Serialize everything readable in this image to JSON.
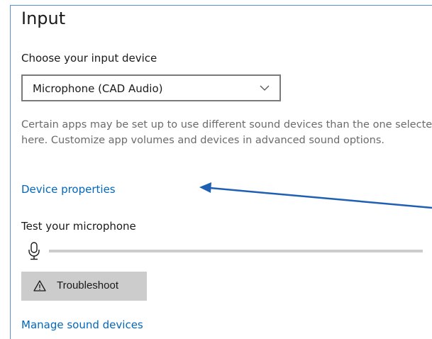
{
  "section": {
    "title": "Input"
  },
  "input_device": {
    "label": "Choose your input device",
    "selected": "Microphone (CAD Audio)",
    "chevron_icon": "chevron-down-icon"
  },
  "description": "Certain apps may be set up to use different sound devices than the one selected here. Customize app volumes and devices in advanced sound options.",
  "links": {
    "device_properties": "Device properties",
    "manage_sound_devices": "Manage sound devices"
  },
  "test": {
    "label": "Test your microphone",
    "mic_icon": "microphone-icon",
    "level": 0
  },
  "troubleshoot": {
    "label": "Troubleshoot",
    "icon": "warning-icon"
  },
  "colors": {
    "link": "#0067c0",
    "annotation_arrow": "#1f5fb4",
    "button_bg": "#cccccc"
  }
}
